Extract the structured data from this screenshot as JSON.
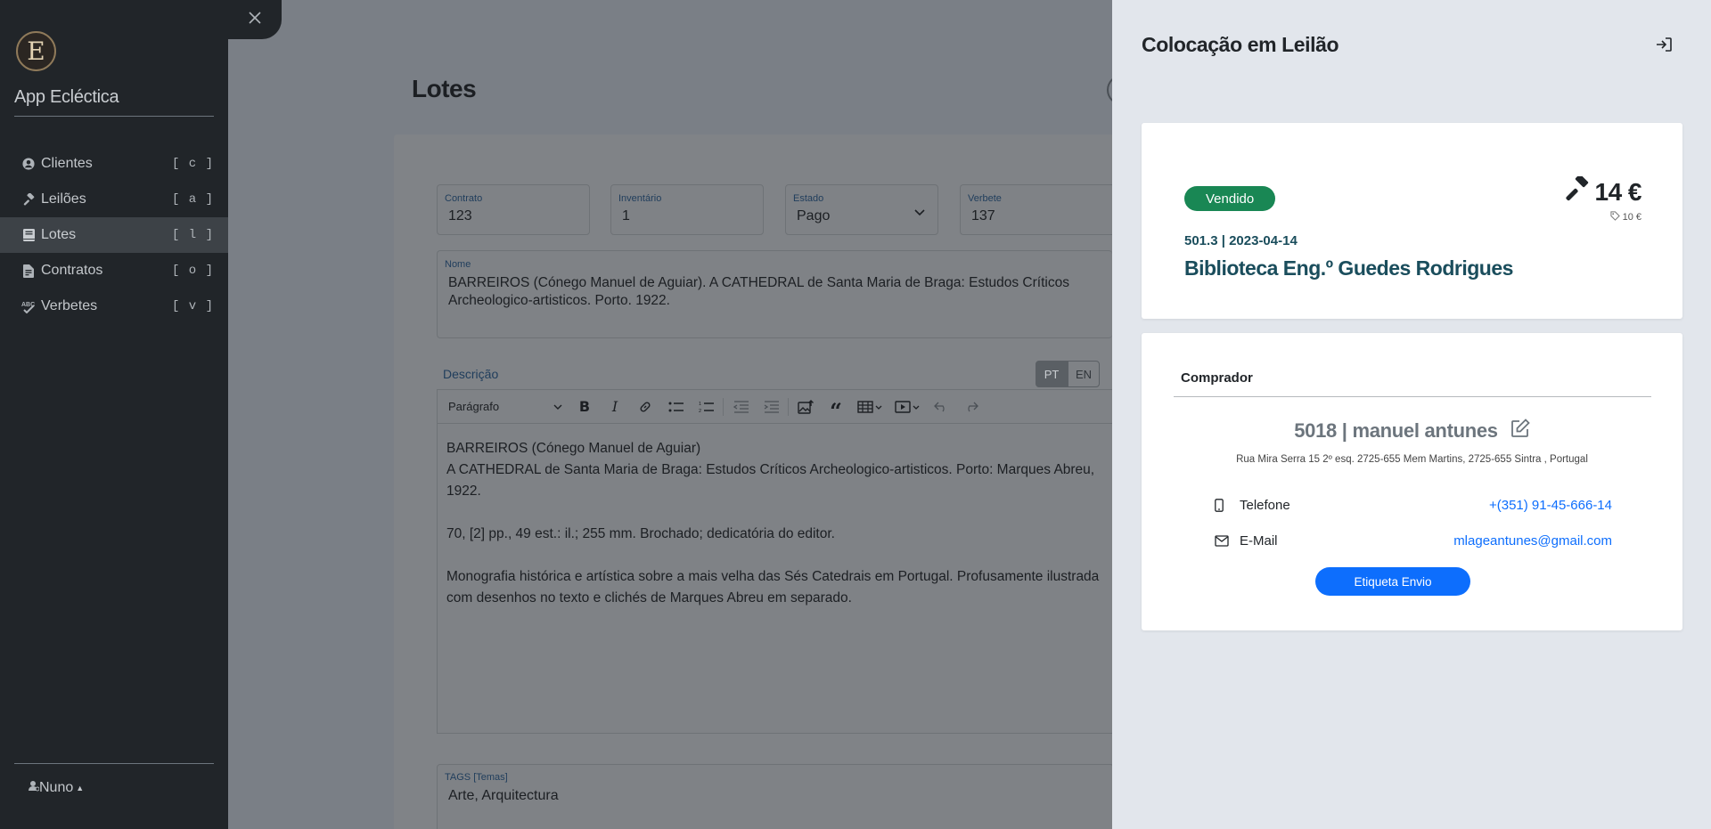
{
  "sidebar": {
    "logo_letter": "E",
    "app_title": "App Ecléctica",
    "items": [
      {
        "label": "Clientes",
        "key": "[ c ]",
        "icon": "user-circle-icon"
      },
      {
        "label": "Leilões",
        "key": "[ a ]",
        "icon": "gavel-icon"
      },
      {
        "label": "Lotes",
        "key": "[ l ]",
        "icon": "book-icon",
        "active": true
      },
      {
        "label": "Contratos",
        "key": "[ o ]",
        "icon": "contract-icon"
      },
      {
        "label": "Verbetes",
        "key": "[ v ]",
        "icon": "spell-check-icon"
      }
    ],
    "user": "Nuno"
  },
  "main": {
    "title": "Lotes",
    "fields": {
      "contrato": {
        "label": "Contrato",
        "value": "123"
      },
      "inventario": {
        "label": "Inventário",
        "value": "1"
      },
      "estado": {
        "label": "Estado",
        "value": "Pago"
      },
      "verbete": {
        "label": "Verbete",
        "value": "137"
      },
      "nome": {
        "label": "Nome",
        "value": "BARREIROS (Cónego Manuel de Aguiar). A CATHEDRAL de Santa Maria de Braga: Estudos Críticos Archeologico-artisticos. Porto. 1922."
      }
    },
    "descricao": {
      "label": "Descrição",
      "lang_pt": "PT",
      "lang_en": "EN",
      "format": "Parágrafo",
      "paragraphs": [
        "BARREIROS (Cónego Manuel de Aguiar)",
        "A CATHEDRAL de Santa Maria de Braga: Estudos Críticos Archeologico-artisticos. Porto: Marques Abreu, 1922.",
        "70, [2] pp., 49 est.: il.; 255 mm. Brochado; dedicatória do editor.",
        "Monografia histórica e artística sobre a mais velha das Sés Catedrais em Portugal. Profusamente ilustrada com desenhos no texto e clichés de Marques Abreu em separado."
      ]
    },
    "tags": {
      "label": "TAGS [Temas]",
      "value": "Arte, Arquitectura"
    }
  },
  "panel": {
    "title": "Colocação em Leilão",
    "lot": {
      "status": "Vendido",
      "status_color": "#198754",
      "price": "14 €",
      "base_price": "10 €",
      "ref": "501.3 | 2023-04-14",
      "auction_name": "Biblioteca Eng.º Guedes Rodrigues"
    },
    "buyer": {
      "heading": "Comprador",
      "name": "5018 | manuel antunes",
      "address": "Rua Mira Serra 15 2º esq. 2725-655 Mem Martins, 2725-655 Sintra , Portugal",
      "phone_label": "Telefone",
      "phone": "+(351) 91-45-666-14",
      "email_label": "E-Mail",
      "email": "mlageantunes@gmail.com",
      "ship_button": "Etiqueta Envio"
    }
  }
}
